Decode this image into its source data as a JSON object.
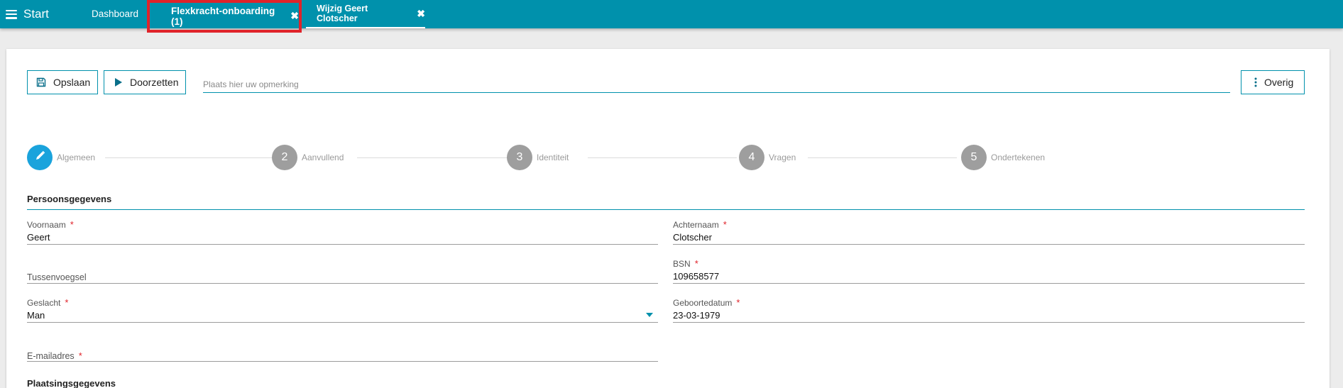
{
  "topbar": {
    "menu_label": "Start",
    "tabs": [
      {
        "label": "Dashboard"
      },
      {
        "label": "Flexkracht-onboarding (1)"
      },
      {
        "label": "Wijzig Geert Clotscher"
      }
    ],
    "close_glyph": "✖",
    "background_color": "#0091ac",
    "highlight_color": "#e0232a"
  },
  "toolbar": {
    "save_label": "Opslaan",
    "forward_label": "Doorzetten",
    "remark_placeholder": "Plaats hier uw opmerking",
    "more_label": "Overig"
  },
  "stepper": {
    "steps": [
      {
        "number": "",
        "label": "Algemeen",
        "active": true,
        "icon": "pencil-icon"
      },
      {
        "number": "2",
        "label": "Aanvullend"
      },
      {
        "number": "3",
        "label": "Identiteit"
      },
      {
        "number": "4",
        "label": "Vragen"
      },
      {
        "number": "5",
        "label": "Ondertekenen"
      }
    ],
    "active_color": "#1aa3dc",
    "inactive_color": "#9e9e9e"
  },
  "sections": {
    "persoonsgegevens": "Persoonsgegevens",
    "plaatsingsgegevens": "Plaatsingsgegevens"
  },
  "fields": {
    "voornaam": {
      "label": "Voornaam",
      "value": "Geert",
      "required": "*"
    },
    "achternaam": {
      "label": "Achternaam",
      "value": "Clotscher",
      "required": "*"
    },
    "tussenvoegsel": {
      "label": "Tussenvoegsel",
      "value": ""
    },
    "bsn": {
      "label": "BSN",
      "value": "109658577",
      "required": "*"
    },
    "geslacht": {
      "label": "Geslacht",
      "value": "Man",
      "required": "*"
    },
    "geboortedatum": {
      "label": "Geboortedatum",
      "value": "23-03-1979",
      "required": "*"
    },
    "email": {
      "label": "E-mailadres",
      "value": "",
      "required": "*"
    }
  }
}
